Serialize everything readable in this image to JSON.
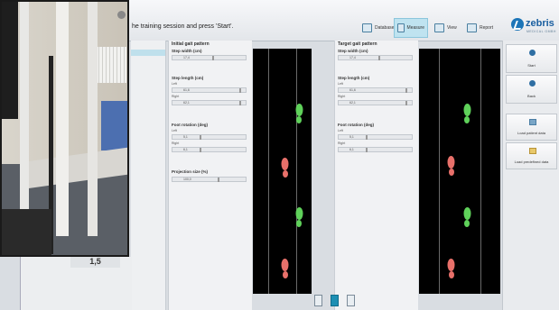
{
  "header": {
    "instruction": "he training session and press 'Start'.",
    "nav": [
      {
        "label": "Database",
        "icon": "database-icon",
        "active": false
      },
      {
        "label": "Measure",
        "icon": "measure-icon",
        "active": true
      },
      {
        "label": "View",
        "icon": "view-icon",
        "active": false
      },
      {
        "label": "Report",
        "icon": "report-icon",
        "active": false
      }
    ],
    "logo": {
      "name": "zebris",
      "tagline": "MEDICAL GMBH"
    }
  },
  "initial": {
    "title": "Initial gait pattern",
    "step_width": {
      "label": "Step width (cm)",
      "value": "17,4"
    },
    "step_length": {
      "label": "Step length (cm)",
      "left_label": "Left",
      "left": "61,6",
      "right_label": "Right",
      "right": "62,1"
    },
    "foot_rotation": {
      "label": "Foot rotation (deg)",
      "left_label": "Left",
      "left": "5,1",
      "right_label": "Right",
      "right": "6,1"
    },
    "projection": {
      "label": "Projection size (%)",
      "value": "100,0"
    }
  },
  "target": {
    "title": "Target gait pattern",
    "step_width": {
      "label": "Step width (cm)",
      "value": "17,4"
    },
    "step_length": {
      "label": "Step length (cm)",
      "left_label": "Left",
      "left": "61,6",
      "right_label": "Right",
      "right": "62,1"
    },
    "foot_rotation": {
      "label": "Foot rotation (deg)",
      "left_label": "Left",
      "left": "5,1",
      "right_label": "Right",
      "right": "6,1"
    }
  },
  "actions": {
    "start": "Start",
    "back": "Back",
    "load_patient": "Load patient data",
    "load_predefined": "Load predefined data"
  },
  "video": {
    "counter": "1,5"
  },
  "colors": {
    "left_foot": "#5fd15a",
    "right_foot": "#e8706a",
    "accent": "#1d8fb3"
  }
}
